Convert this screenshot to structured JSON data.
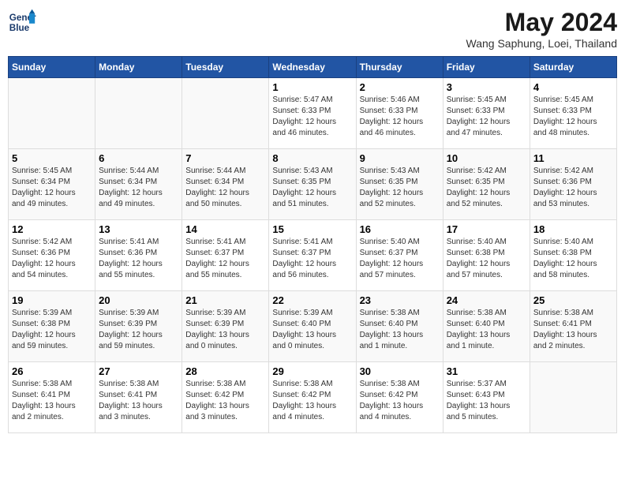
{
  "header": {
    "logo_line1": "General",
    "logo_line2": "Blue",
    "month_title": "May 2024",
    "location": "Wang Saphung, Loei, Thailand"
  },
  "weekdays": [
    "Sunday",
    "Monday",
    "Tuesday",
    "Wednesday",
    "Thursday",
    "Friday",
    "Saturday"
  ],
  "weeks": [
    [
      {
        "day": "",
        "info": ""
      },
      {
        "day": "",
        "info": ""
      },
      {
        "day": "",
        "info": ""
      },
      {
        "day": "1",
        "info": "Sunrise: 5:47 AM\nSunset: 6:33 PM\nDaylight: 12 hours\nand 46 minutes."
      },
      {
        "day": "2",
        "info": "Sunrise: 5:46 AM\nSunset: 6:33 PM\nDaylight: 12 hours\nand 46 minutes."
      },
      {
        "day": "3",
        "info": "Sunrise: 5:45 AM\nSunset: 6:33 PM\nDaylight: 12 hours\nand 47 minutes."
      },
      {
        "day": "4",
        "info": "Sunrise: 5:45 AM\nSunset: 6:33 PM\nDaylight: 12 hours\nand 48 minutes."
      }
    ],
    [
      {
        "day": "5",
        "info": "Sunrise: 5:45 AM\nSunset: 6:34 PM\nDaylight: 12 hours\nand 49 minutes."
      },
      {
        "day": "6",
        "info": "Sunrise: 5:44 AM\nSunset: 6:34 PM\nDaylight: 12 hours\nand 49 minutes."
      },
      {
        "day": "7",
        "info": "Sunrise: 5:44 AM\nSunset: 6:34 PM\nDaylight: 12 hours\nand 50 minutes."
      },
      {
        "day": "8",
        "info": "Sunrise: 5:43 AM\nSunset: 6:35 PM\nDaylight: 12 hours\nand 51 minutes."
      },
      {
        "day": "9",
        "info": "Sunrise: 5:43 AM\nSunset: 6:35 PM\nDaylight: 12 hours\nand 52 minutes."
      },
      {
        "day": "10",
        "info": "Sunrise: 5:42 AM\nSunset: 6:35 PM\nDaylight: 12 hours\nand 52 minutes."
      },
      {
        "day": "11",
        "info": "Sunrise: 5:42 AM\nSunset: 6:36 PM\nDaylight: 12 hours\nand 53 minutes."
      }
    ],
    [
      {
        "day": "12",
        "info": "Sunrise: 5:42 AM\nSunset: 6:36 PM\nDaylight: 12 hours\nand 54 minutes."
      },
      {
        "day": "13",
        "info": "Sunrise: 5:41 AM\nSunset: 6:36 PM\nDaylight: 12 hours\nand 55 minutes."
      },
      {
        "day": "14",
        "info": "Sunrise: 5:41 AM\nSunset: 6:37 PM\nDaylight: 12 hours\nand 55 minutes."
      },
      {
        "day": "15",
        "info": "Sunrise: 5:41 AM\nSunset: 6:37 PM\nDaylight: 12 hours\nand 56 minutes."
      },
      {
        "day": "16",
        "info": "Sunrise: 5:40 AM\nSunset: 6:37 PM\nDaylight: 12 hours\nand 57 minutes."
      },
      {
        "day": "17",
        "info": "Sunrise: 5:40 AM\nSunset: 6:38 PM\nDaylight: 12 hours\nand 57 minutes."
      },
      {
        "day": "18",
        "info": "Sunrise: 5:40 AM\nSunset: 6:38 PM\nDaylight: 12 hours\nand 58 minutes."
      }
    ],
    [
      {
        "day": "19",
        "info": "Sunrise: 5:39 AM\nSunset: 6:38 PM\nDaylight: 12 hours\nand 59 minutes."
      },
      {
        "day": "20",
        "info": "Sunrise: 5:39 AM\nSunset: 6:39 PM\nDaylight: 12 hours\nand 59 minutes."
      },
      {
        "day": "21",
        "info": "Sunrise: 5:39 AM\nSunset: 6:39 PM\nDaylight: 13 hours\nand 0 minutes."
      },
      {
        "day": "22",
        "info": "Sunrise: 5:39 AM\nSunset: 6:40 PM\nDaylight: 13 hours\nand 0 minutes."
      },
      {
        "day": "23",
        "info": "Sunrise: 5:38 AM\nSunset: 6:40 PM\nDaylight: 13 hours\nand 1 minute."
      },
      {
        "day": "24",
        "info": "Sunrise: 5:38 AM\nSunset: 6:40 PM\nDaylight: 13 hours\nand 1 minute."
      },
      {
        "day": "25",
        "info": "Sunrise: 5:38 AM\nSunset: 6:41 PM\nDaylight: 13 hours\nand 2 minutes."
      }
    ],
    [
      {
        "day": "26",
        "info": "Sunrise: 5:38 AM\nSunset: 6:41 PM\nDaylight: 13 hours\nand 2 minutes."
      },
      {
        "day": "27",
        "info": "Sunrise: 5:38 AM\nSunset: 6:41 PM\nDaylight: 13 hours\nand 3 minutes."
      },
      {
        "day": "28",
        "info": "Sunrise: 5:38 AM\nSunset: 6:42 PM\nDaylight: 13 hours\nand 3 minutes."
      },
      {
        "day": "29",
        "info": "Sunrise: 5:38 AM\nSunset: 6:42 PM\nDaylight: 13 hours\nand 4 minutes."
      },
      {
        "day": "30",
        "info": "Sunrise: 5:38 AM\nSunset: 6:42 PM\nDaylight: 13 hours\nand 4 minutes."
      },
      {
        "day": "31",
        "info": "Sunrise: 5:37 AM\nSunset: 6:43 PM\nDaylight: 13 hours\nand 5 minutes."
      },
      {
        "day": "",
        "info": ""
      }
    ]
  ]
}
